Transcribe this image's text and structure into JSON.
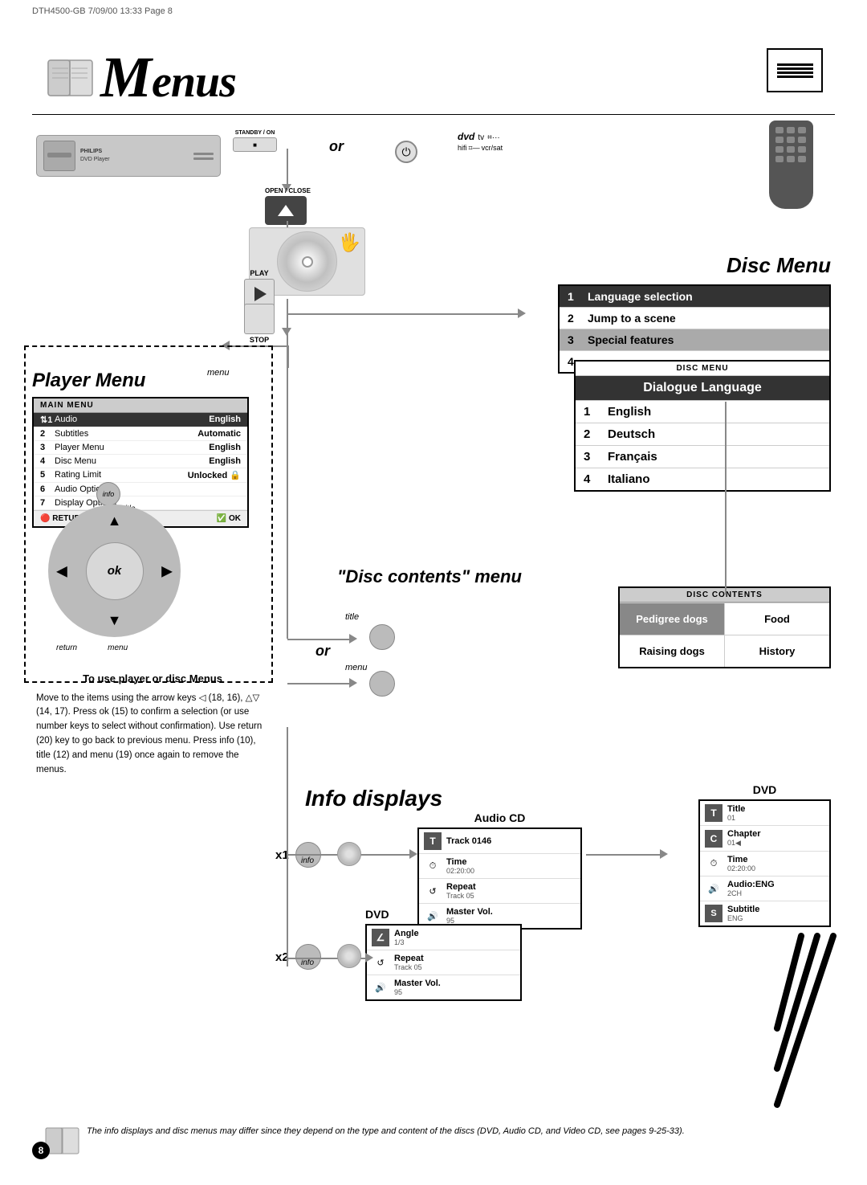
{
  "header": {
    "docref": "DTH4500-GB   7/09/00  13:33   Page 8",
    "title": "Menus"
  },
  "disc_menu": {
    "title": "Disc Menu",
    "items": [
      {
        "num": "1",
        "label": "Language selection"
      },
      {
        "num": "2",
        "label": "Jump to a scene"
      },
      {
        "num": "3",
        "label": "Special features"
      },
      {
        "num": "4",
        "label": ""
      }
    ],
    "submenu_header": "DISC MENU",
    "dialogue_title": "Dialogue Language",
    "languages": [
      {
        "num": "1",
        "label": "English"
      },
      {
        "num": "2",
        "label": "Deutsch"
      },
      {
        "num": "3",
        "label": "Français"
      },
      {
        "num": "4",
        "label": "Italiano"
      }
    ]
  },
  "player_menu": {
    "title": "Player Menu",
    "header": "MAIN MENU",
    "items": [
      {
        "num": "1",
        "label": "Audio",
        "value": "English",
        "highlighted": true
      },
      {
        "num": "2",
        "label": "Subtitles",
        "value": "Automatic"
      },
      {
        "num": "3",
        "label": "Player Menu",
        "value": "English"
      },
      {
        "num": "4",
        "label": "Disc Menu",
        "value": "English"
      },
      {
        "num": "5",
        "label": "Rating Limit",
        "value": "Unlocked"
      },
      {
        "num": "6",
        "label": "Audio Options",
        "value": ""
      },
      {
        "num": "7",
        "label": "Display Options",
        "value": ""
      }
    ],
    "return_label": "RETURN",
    "ok_label": "OK"
  },
  "disc_contents": {
    "section_title": "\"Disc contents\" menu",
    "header": "DISC CONTENTS",
    "cells": [
      {
        "label": "Pedigree dogs",
        "highlighted": true
      },
      {
        "label": "Food",
        "highlighted": false
      },
      {
        "label": "Raising dogs",
        "highlighted": false
      },
      {
        "label": "History",
        "highlighted": false
      }
    ]
  },
  "info_displays": {
    "title": "Info displays",
    "audio_cd_label": "Audio CD",
    "audio_cd_items": [
      {
        "icon": "T",
        "text": "Track 0146",
        "sub": ""
      },
      {
        "icon": "⏱",
        "text": "Time",
        "sub": "02:20:00"
      },
      {
        "icon": "↺",
        "text": "Repeat",
        "sub": "Track 05"
      },
      {
        "icon": "🔊",
        "text": "Master Vol.",
        "sub": "95"
      }
    ],
    "dvd_x1_label": "DVD",
    "dvd_x1_items": [
      {
        "icon": "T",
        "text": "Title",
        "sub": "01"
      },
      {
        "icon": "C",
        "text": "Chapter",
        "sub": "01◀"
      },
      {
        "icon": "⏱",
        "text": "Time",
        "sub": "02:20:00"
      },
      {
        "icon": "🔊",
        "text": "Audio:ENG",
        "sub": "2CH"
      },
      {
        "icon": "S",
        "text": "Subtitle",
        "sub": "ENG"
      }
    ],
    "dvd_x2_label": "DVD",
    "dvd_x2_items": [
      {
        "icon": "∠",
        "text": "Angle",
        "sub": "1/3"
      },
      {
        "icon": "↺",
        "text": "Repeat",
        "sub": "Track 05"
      },
      {
        "icon": "M",
        "text": "Master Vol.",
        "sub": "95"
      }
    ]
  },
  "controls": {
    "standby_label": "STANDBY / ON",
    "open_close_label": "OPEN / CLOSE",
    "play_label": "PLAY",
    "stop_label": "STOP",
    "ok_label": "ok",
    "info_label": "info",
    "title_label": "title",
    "return_label": "return",
    "menu_label": "menu"
  },
  "instruction": {
    "title": "To use player or disc Menus",
    "body": "Move to the items using the arrow keys ◁ (18, 16), △▽ (14, 17). Press ok (15) to confirm a selection (or use number keys to select without confirmation). Use return (20) key to go back to previous menu. Press info (10), title (12) and menu (19) once again to remove the menus."
  },
  "footnote": "The info displays and disc menus may differ since they depend on the type and content of the discs (DVD, Audio CD, and Video CD, see pages 9-25-33).",
  "page_number": "8",
  "source_labels": {
    "dvd": "dvd",
    "tv": "tv",
    "hifi": "hifi",
    "vcr_sat": "vcr/sat"
  },
  "or_label": "or",
  "menu_arrow_labels": {
    "menu1": "menu",
    "menu2": "menu",
    "title1": "title",
    "title2": "title"
  }
}
